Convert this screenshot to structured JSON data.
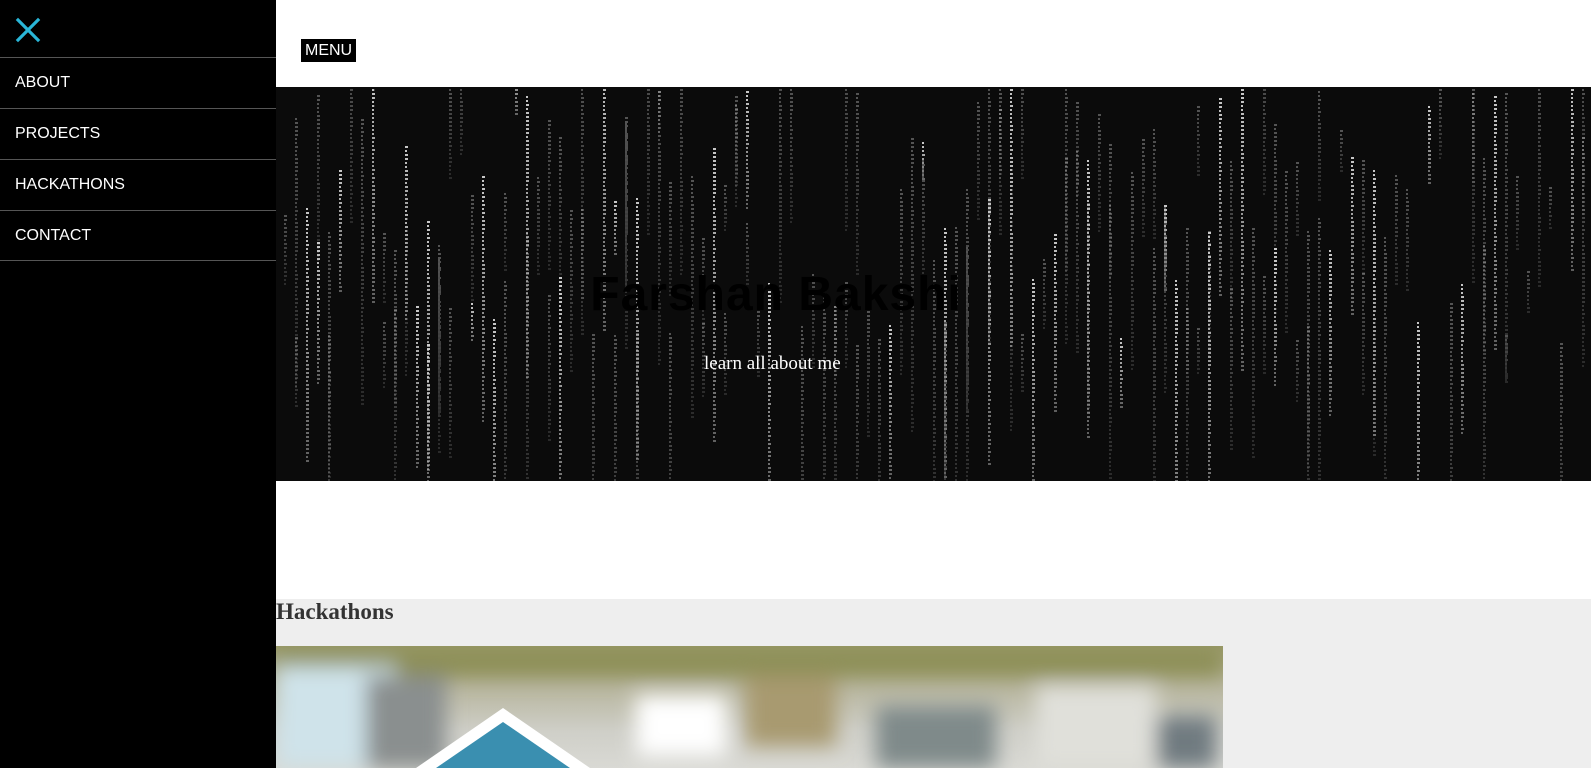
{
  "sidebar": {
    "close_icon": "close-icon",
    "accent_color": "#29b6d8",
    "items": [
      {
        "label": "ABOUT"
      },
      {
        "label": "PROJECTS"
      },
      {
        "label": "HACKATHONS"
      },
      {
        "label": "CONTACT"
      }
    ]
  },
  "header": {
    "menu_label": "MENU"
  },
  "hero": {
    "title": "Farshan Bakshi",
    "link_label": "learn all about me",
    "background": "matrix-code-rain"
  },
  "hackathons": {
    "title": "Hackathons",
    "image": "hackathon-photo"
  }
}
